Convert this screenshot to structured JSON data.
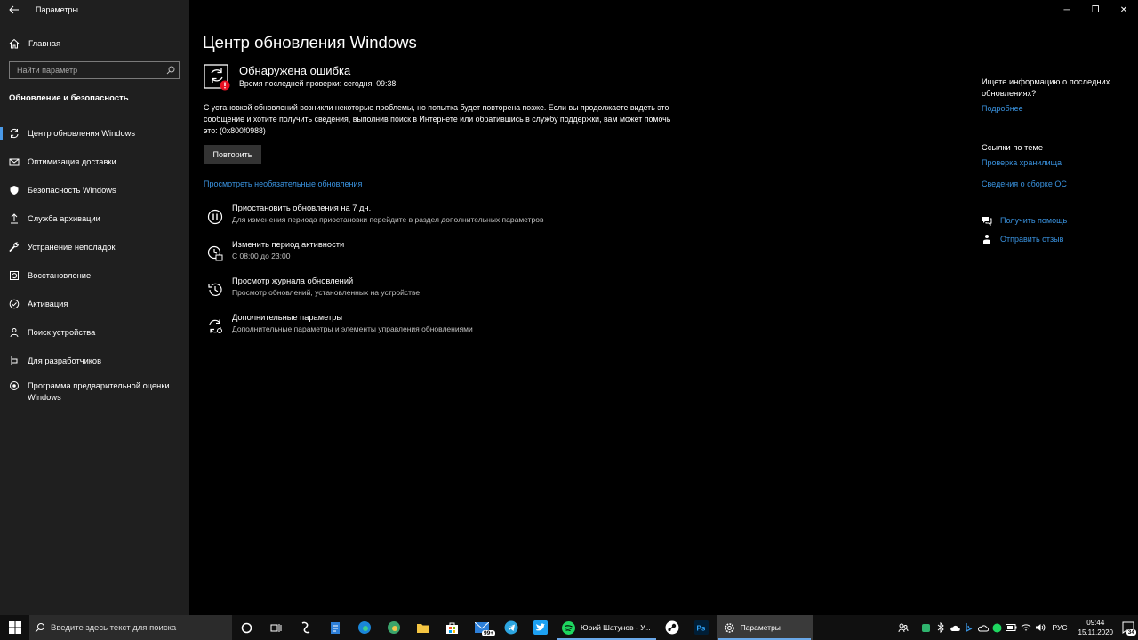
{
  "window": {
    "app_title": "Параметры",
    "back_glyph": "←",
    "minimize_glyph": "─",
    "maximize_glyph": "❐",
    "close_glyph": "✕"
  },
  "sidebar": {
    "home_label": "Главная",
    "search_placeholder": "Найти параметр",
    "section_title": "Обновление и безопасность",
    "items": [
      {
        "label": "Центр обновления Windows",
        "icon": "sync-icon",
        "active": true
      },
      {
        "label": "Оптимизация доставки",
        "icon": "delivery-icon"
      },
      {
        "label": "Безопасность Windows",
        "icon": "shield-icon"
      },
      {
        "label": "Служба архивации",
        "icon": "backup-icon"
      },
      {
        "label": "Устранение неполадок",
        "icon": "wrench-icon"
      },
      {
        "label": "Восстановление",
        "icon": "recovery-icon"
      },
      {
        "label": "Активация",
        "icon": "check-circle-icon"
      },
      {
        "label": "Поиск устройства",
        "icon": "person-pin-icon"
      },
      {
        "label": "Для разработчиков",
        "icon": "developer-icon"
      },
      {
        "label": "Программа предварительной оценки Windows",
        "icon": "insider-icon"
      }
    ]
  },
  "main": {
    "page_title": "Центр обновления Windows",
    "status_title": "Обнаружена ошибка",
    "status_sub": "Время последней проверки: сегодня, 09:38",
    "error_text": "С установкой обновлений возникли некоторые проблемы, но попытка будет повторена позже. Если вы продолжаете видеть это сообщение и хотите получить сведения, выполнив поиск в Интернете или обратившись в службу поддержки, вам может помочь это: (0x800f0988)",
    "retry_label": "Повторить",
    "optional_link": "Просмотреть необязательные обновления",
    "options": [
      {
        "title": "Приостановить обновления на 7 дн.",
        "desc": "Для изменения периода приостановки перейдите в раздел дополнительных параметров",
        "icon": "pause-icon"
      },
      {
        "title": "Изменить период активности",
        "desc": "С 08:00 до 23:00",
        "icon": "active-hours-icon"
      },
      {
        "title": "Просмотр журнала обновлений",
        "desc": "Просмотр обновлений, установленных на устройстве",
        "icon": "history-icon"
      },
      {
        "title": "Дополнительные параметры",
        "desc": "Дополнительные параметры и элементы управления обновлениями",
        "icon": "advanced-options-icon"
      }
    ]
  },
  "right_panel": {
    "question": "Ищете информацию о последних обновлениях?",
    "more_link": "Подробнее",
    "related_title": "Ссылки по теме",
    "link_storage": "Проверка хранилища",
    "link_build": "Сведения о сборке ОС",
    "help_link": "Получить помощь",
    "feedback_link": "Отправить отзыв"
  },
  "taskbar": {
    "search_placeholder": "Введите здесь текст для поиска",
    "spotify_label": "Юрий Шатунов - У...",
    "settings_label": "Параметры",
    "mail_badge": "99+",
    "language": "РУС",
    "time": "09:44",
    "date": "15.11.2020",
    "notifications_count": "34"
  },
  "colors": {
    "accent": "#3a93e0",
    "sidebar_bg": "#1f1f1f",
    "main_bg": "#000000",
    "error_red": "#e81123"
  }
}
